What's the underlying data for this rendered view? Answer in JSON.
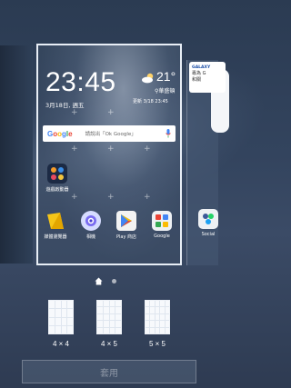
{
  "clock": {
    "time": "23:45",
    "date": "3月18日, 週五"
  },
  "weather": {
    "temp": "21°",
    "location": "華盛頓",
    "updated": "更新 3/18 23:45"
  },
  "search": {
    "logo": "Google",
    "hint": "請說出「Ok Google」"
  },
  "apps_row1": [
    {
      "label": "遊戲啟動器",
      "icon": "game-launcher-icon"
    }
  ],
  "dock": [
    {
      "label": "媒體瀏覽器",
      "icon": "media-browser-icon"
    },
    {
      "label": "相機",
      "icon": "camera-icon"
    },
    {
      "label": "Play 商店",
      "icon": "play-store-icon"
    },
    {
      "label": "Google",
      "icon": "google-folder-icon"
    }
  ],
  "next_page": {
    "card_line1": "GALAXY",
    "card_line2": "專為 G",
    "card_line3": "和關",
    "dock_label": "Social"
  },
  "grid_options": [
    {
      "label": "4 × 4"
    },
    {
      "label": "4 × 5"
    },
    {
      "label": "5 × 5"
    }
  ],
  "apply_label": "套用",
  "colors": {
    "background": "#33445e",
    "preview_border": "#e8eef6"
  }
}
